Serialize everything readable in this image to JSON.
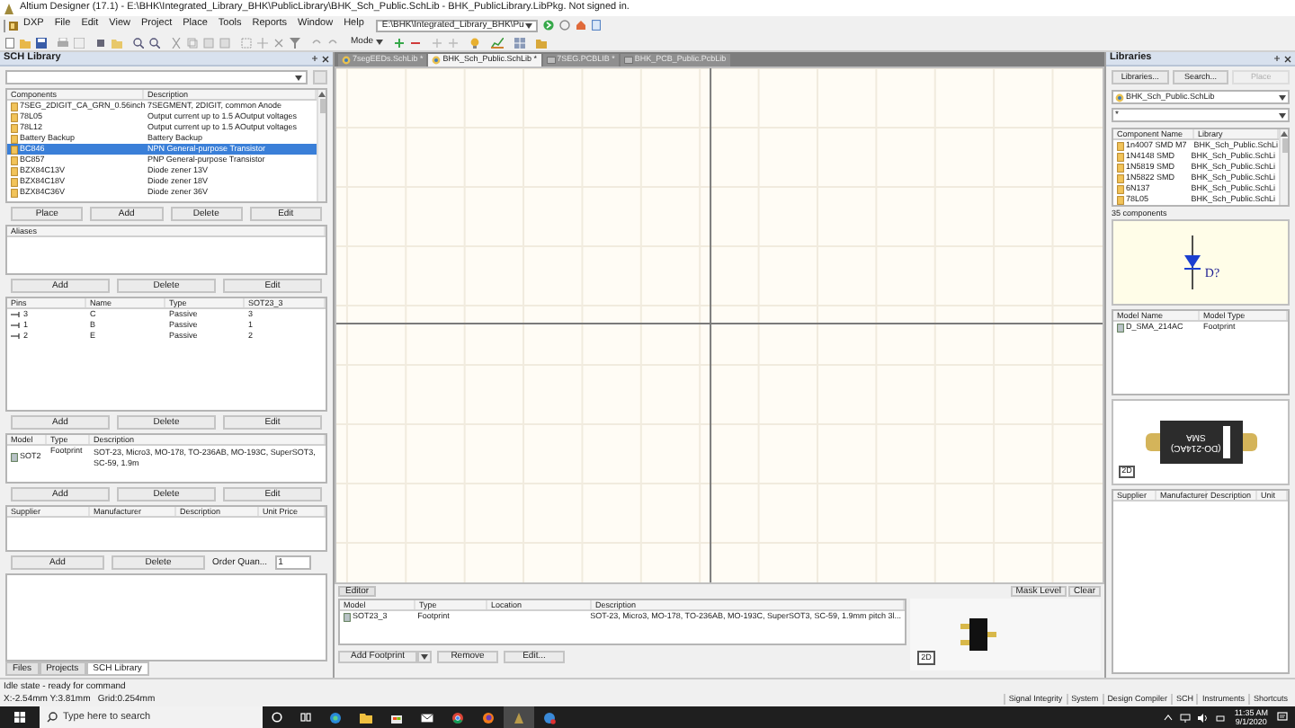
{
  "window": {
    "title": "Altium Designer (17.1) - E:\\BHK\\Integrated_Library_BHK\\PublicLibrary\\BHK_Sch_Public.SchLib - BHK_PublicLibrary.LibPkg. Not signed in."
  },
  "menu": [
    "DXP",
    "File",
    "Edit",
    "View",
    "Project",
    "Place",
    "Tools",
    "Reports",
    "Window",
    "Help"
  ],
  "path_box": "E:\\BHK\\Integrated_Library_BHK\\Pu",
  "toolbar": {
    "mode": "Mode"
  },
  "sch_library": {
    "title": "SCH Library",
    "components": {
      "columns": [
        "Components",
        "Description"
      ],
      "rows": [
        {
          "name": "7SEG_2DIGIT_CA_GRN_0.56inch",
          "description": "7SEGMENT, 2DIGIT, common Anode",
          "selected": false
        },
        {
          "name": "78L05",
          "description": "Output current up to 1.5 AOutput voltages",
          "selected": false
        },
        {
          "name": "78L12",
          "description": "Output current up to 1.5 AOutput voltages",
          "selected": false
        },
        {
          "name": "Battery Backup",
          "description": "Battery Backup",
          "selected": false
        },
        {
          "name": "BC846",
          "description": "NPN General-purpose Transistor",
          "selected": true
        },
        {
          "name": "BC857",
          "description": "PNP General-purpose Transistor",
          "selected": false
        },
        {
          "name": "BZX84C13V",
          "description": "Diode zener 13V",
          "selected": false
        },
        {
          "name": "BZX84C18V",
          "description": "Diode zener 18V",
          "selected": false
        },
        {
          "name": "BZX84C36V",
          "description": "Diode zener 36V",
          "selected": false
        }
      ]
    },
    "component_buttons": [
      "Place",
      "Add",
      "Delete",
      "Edit"
    ],
    "aliases": {
      "columns": [
        "Aliases"
      ]
    },
    "alias_buttons": [
      "Add",
      "Delete",
      "Edit"
    ],
    "pins": {
      "columns": [
        "Pins",
        "Name",
        "Type",
        "SOT23_3"
      ],
      "rows": [
        {
          "pin": "3",
          "name": "C",
          "type": "Passive",
          "designator": "3"
        },
        {
          "pin": "1",
          "name": "B",
          "type": "Passive",
          "designator": "1"
        },
        {
          "pin": "2",
          "name": "E",
          "type": "Passive",
          "designator": "2"
        }
      ]
    },
    "pin_buttons": [
      "Add",
      "Delete",
      "Edit"
    ],
    "models": {
      "columns": [
        "Model",
        "Type",
        "Description"
      ],
      "rows": [
        {
          "model": "SOT2",
          "type": "Footprint",
          "description": "SOT-23, Micro3, MO-178, TO-236AB, MO-193C, SuperSOT3, SC-59, 1.9m"
        }
      ]
    },
    "model_buttons": [
      "Add",
      "Delete",
      "Edit"
    ],
    "suppliers": {
      "columns": [
        "Supplier",
        "Manufacturer",
        "Description",
        "Unit Price"
      ]
    },
    "supplier_buttons": [
      "Add",
      "Delete"
    ],
    "order_label": "Order Quan...",
    "order_value": "1",
    "tabs": [
      {
        "label": "Files",
        "selected": false
      },
      {
        "label": "Projects",
        "selected": false
      },
      {
        "label": "SCH Library",
        "selected": true
      }
    ]
  },
  "documents": [
    {
      "label": "7segEEDs.SchLib *",
      "kind": "schlib",
      "selected": false
    },
    {
      "label": "BHK_Sch_Public.SchLib *",
      "kind": "schlib",
      "selected": true
    },
    {
      "label": "7SEG.PCBLIB *",
      "kind": "pcblib",
      "selected": false
    },
    {
      "label": "BHK_PCB_Public.PcbLib",
      "kind": "pcblib",
      "selected": false
    }
  ],
  "editor": {
    "tab": "Editor",
    "mask_level": "Mask Level",
    "clear": "Clear",
    "columns": [
      "Model",
      "Type",
      "Location",
      "Description"
    ],
    "rows": [
      {
        "model": "SOT23_3",
        "type": "Footprint",
        "description": "SOT-23, Micro3, MO-178, TO-236AB, MO-193C, SuperSOT3, SC-59, 1.9mm pitch 3l..."
      }
    ],
    "buttons": [
      "Add Footprint",
      "Remove",
      "Edit..."
    ],
    "preview_mode": "2D"
  },
  "libraries": {
    "title": "Libraries",
    "buttons": [
      {
        "label": "Libraries...",
        "disabled": false
      },
      {
        "label": "Search...",
        "disabled": false
      },
      {
        "label": "Place",
        "disabled": true
      }
    ],
    "library": "BHK_Sch_Public.SchLib",
    "filter": "*",
    "columns": [
      "Component Name",
      "Library"
    ],
    "rows": [
      {
        "name": "1n4007 SMD M7",
        "library": "BHK_Sch_Public.SchLi",
        "selected": false
      },
      {
        "name": "1N4148 SMD",
        "library": "BHK_Sch_Public.SchLi",
        "selected": false
      },
      {
        "name": "1N5819 SMD",
        "library": "BHK_Sch_Public.SchLi",
        "selected": false
      },
      {
        "name": "1N5822 SMD",
        "library": "BHK_Sch_Public.SchLi",
        "selected": false
      },
      {
        "name": "6N137",
        "library": "BHK_Sch_Public.SchLi",
        "selected": false
      },
      {
        "name": "78L05",
        "library": "BHK_Sch_Public.SchLi",
        "selected": false
      }
    ],
    "count": "35 components",
    "designator": "D?",
    "model_columns": [
      "Model Name",
      "Model Type"
    ],
    "model_rows": [
      {
        "name": "D_SMA_214AC",
        "type": "Footprint"
      }
    ],
    "package_labels": [
      "(DO-214AC)",
      "SMA"
    ],
    "preview_mode": "2D",
    "supplier_columns": [
      "Supplier",
      "Manufacturer",
      "Description",
      "Unit"
    ]
  },
  "status": {
    "state": "Idle state - ready for command",
    "coords": "X:-2.54mm Y:3.81mm   Grid:0.254mm",
    "panels": [
      "Signal Integrity",
      "System",
      "Design Compiler",
      "SCH",
      "Instruments",
      "Shortcuts"
    ]
  },
  "taskbar": {
    "search_placeholder": "Type here to search",
    "apps": [
      {
        "kind": "edge",
        "selected": false
      },
      {
        "kind": "explorer",
        "selected": false
      },
      {
        "kind": "store",
        "selected": false
      },
      {
        "kind": "mail",
        "selected": false
      },
      {
        "kind": "chrome",
        "selected": false
      },
      {
        "kind": "firefox",
        "selected": false
      },
      {
        "kind": "altium",
        "selected": true
      },
      {
        "kind": "globe",
        "selected": false
      }
    ],
    "time": "11:35 AM",
    "date": "9/1/2020"
  }
}
